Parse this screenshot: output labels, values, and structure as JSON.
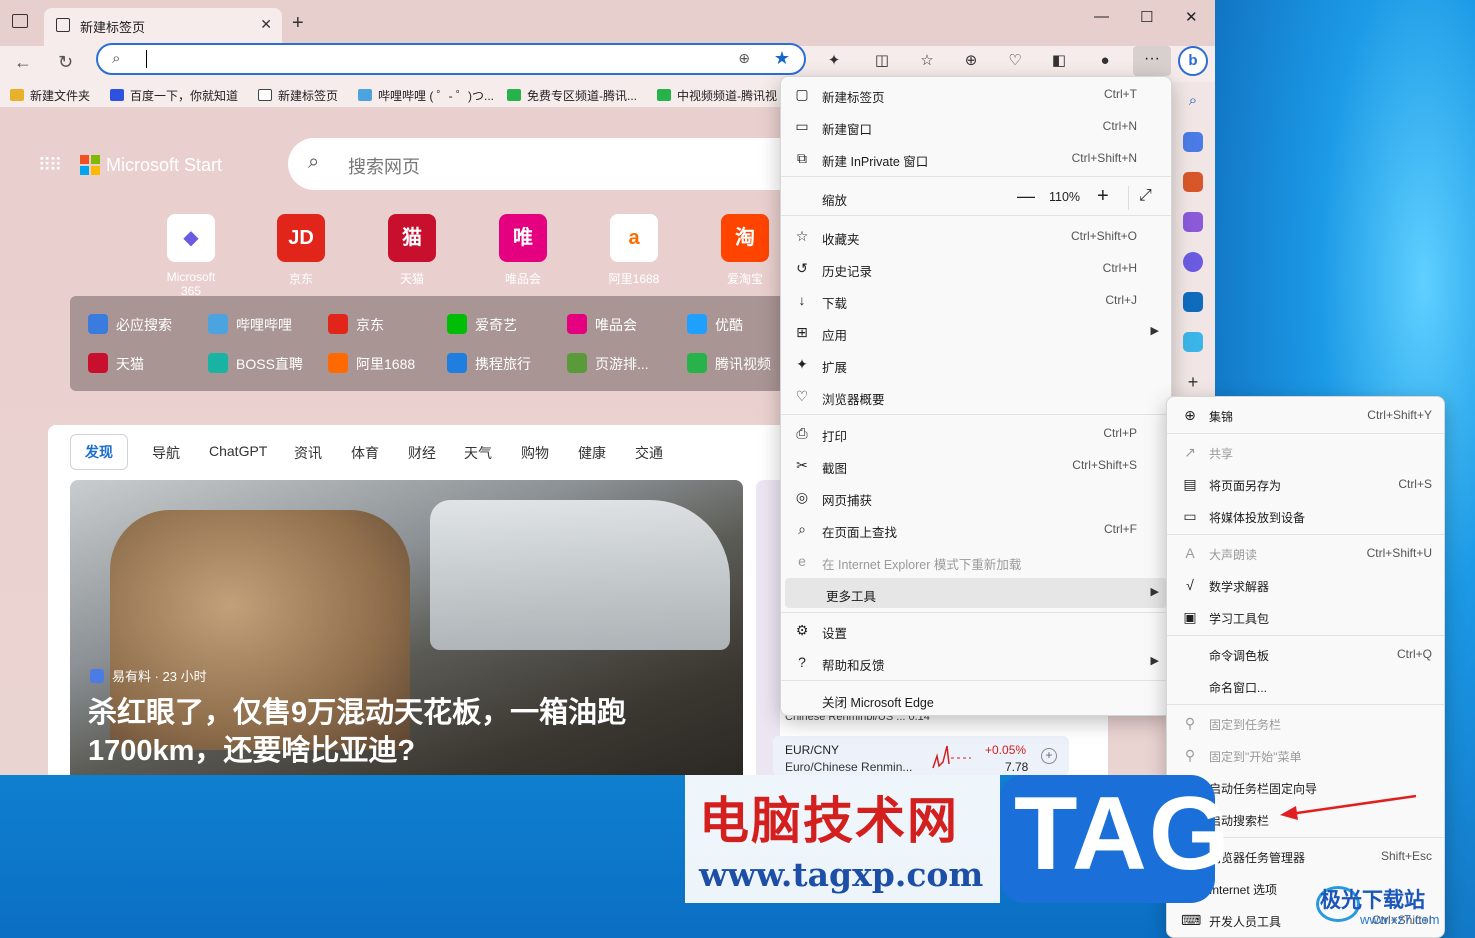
{
  "browser": {
    "tab_title": "新建标签页",
    "fav_bar": [
      {
        "label": "新建文件夹",
        "color": "#e8b12c"
      },
      {
        "label": "百度一下，你就知道",
        "color": "#2d52e0"
      },
      {
        "label": "新建标签页",
        "color": "#444444"
      },
      {
        "label": "哔哩哔哩 ( ゜- ゜)つ...",
        "color": "#4ba3e0"
      },
      {
        "label": "免费专区频道-腾讯...",
        "color": "#27b24a"
      },
      {
        "label": "中视频频道-腾讯视",
        "color": "#27b24a"
      }
    ]
  },
  "newtab": {
    "brand": "Microsoft Start",
    "search_placeholder": "搜索网页",
    "quick_links": [
      {
        "label": "Microsoft 365",
        "glyph": "◆",
        "color": "#6a5be0"
      },
      {
        "label": "京东",
        "glyph": "JD",
        "color": "#e1251b"
      },
      {
        "label": "天猫",
        "glyph": "猫",
        "color": "#c8102e"
      },
      {
        "label": "唯品会",
        "glyph": "唯",
        "color": "#e4007f"
      },
      {
        "label": "阿里1688",
        "glyph": "a",
        "color": "#ff6a00"
      },
      {
        "label": "爱淘宝",
        "glyph": "淘",
        "color": "#ff4400"
      }
    ],
    "panel_links": [
      {
        "label": "必应搜索",
        "color": "#3a7be0"
      },
      {
        "label": "哔哩哔哩",
        "color": "#4ba3e0"
      },
      {
        "label": "京东",
        "color": "#e1251b"
      },
      {
        "label": "爱奇艺",
        "color": "#00be06"
      },
      {
        "label": "唯品会",
        "color": "#e4007f"
      },
      {
        "label": "优酷",
        "color": "#1fa0ff"
      },
      {
        "label": "天猫",
        "color": "#c8102e"
      },
      {
        "label": "BOSS直聘",
        "color": "#19b3a3"
      },
      {
        "label": "阿里1688",
        "color": "#ff6a00"
      },
      {
        "label": "携程旅行",
        "color": "#1f7ee0"
      },
      {
        "label": "页游排...",
        "color": "#5b9a3a"
      },
      {
        "label": "腾讯视频",
        "color": "#27b24a"
      }
    ],
    "feed_tabs": [
      "发现",
      "导航",
      "ChatGPT",
      "资讯",
      "体育",
      "财经",
      "天气",
      "购物",
      "健康",
      "交通"
    ],
    "hero": {
      "source": "易有料 · 23 小时",
      "headline": "杀红眼了，仅售9万混动天花板，一箱油跑1700km，还要啥比亚迪?"
    },
    "stock": {
      "partial_top": "Chinese Renminbi/US ...            0.14",
      "pair": "EUR/CNY",
      "name": "Euro/Chinese Renmin...",
      "change": "+0.05%",
      "value": "7.78"
    }
  },
  "menu": {
    "items": [
      {
        "icon": "▢",
        "label": "新建标签页",
        "shortcut": "Ctrl+T"
      },
      {
        "icon": "▭",
        "label": "新建窗口",
        "shortcut": "Ctrl+N"
      },
      {
        "icon": "⧉",
        "label": "新建 InPrivate 窗口",
        "shortcut": "Ctrl+Shift+N"
      },
      {
        "icon": "",
        "label": "缩放",
        "shortcut": ""
      },
      {
        "icon": "☆",
        "label": "收藏夹",
        "shortcut": "Ctrl+Shift+O"
      },
      {
        "icon": "↺",
        "label": "历史记录",
        "shortcut": "Ctrl+H"
      },
      {
        "icon": "↓",
        "label": "下载",
        "shortcut": "Ctrl+J"
      },
      {
        "icon": "⊞",
        "label": "应用",
        "shortcut": ""
      },
      {
        "icon": "✦",
        "label": "扩展",
        "shortcut": ""
      },
      {
        "icon": "♡",
        "label": "浏览器概要",
        "shortcut": ""
      },
      {
        "icon": "⎙",
        "label": "打印",
        "shortcut": "Ctrl+P"
      },
      {
        "icon": "✂",
        "label": "截图",
        "shortcut": "Ctrl+Shift+S"
      },
      {
        "icon": "◎",
        "label": "网页捕获",
        "shortcut": ""
      },
      {
        "icon": "⌕",
        "label": "在页面上查找",
        "shortcut": "Ctrl+F"
      },
      {
        "icon": "e",
        "label": "在 Internet Explorer 模式下重新加载",
        "shortcut": ""
      },
      {
        "icon": "",
        "label": "更多工具",
        "shortcut": ""
      },
      {
        "icon": "⚙",
        "label": "设置",
        "shortcut": ""
      },
      {
        "icon": "?",
        "label": "帮助和反馈",
        "shortcut": ""
      },
      {
        "icon": "",
        "label": "关闭 Microsoft Edge",
        "shortcut": ""
      }
    ],
    "zoom_value": "110%"
  },
  "submenu": {
    "items": [
      {
        "icon": "⊕",
        "label": "集锦",
        "shortcut": "Ctrl+Shift+Y"
      },
      {
        "icon": "↗",
        "label": "共享",
        "shortcut": ""
      },
      {
        "icon": "▤",
        "label": "将页面另存为",
        "shortcut": "Ctrl+S"
      },
      {
        "icon": "▭",
        "label": "将媒体投放到设备",
        "shortcut": ""
      },
      {
        "icon": "A",
        "label": "大声朗读",
        "shortcut": "Ctrl+Shift+U"
      },
      {
        "icon": "√",
        "label": "数学求解器",
        "shortcut": ""
      },
      {
        "icon": "▣",
        "label": "学习工具包",
        "shortcut": ""
      },
      {
        "icon": "",
        "label": "命令调色板",
        "shortcut": "Ctrl+Q"
      },
      {
        "icon": "",
        "label": "命名窗口...",
        "shortcut": ""
      },
      {
        "icon": "⚲",
        "label": "固定到任务栏",
        "shortcut": ""
      },
      {
        "icon": "⚲",
        "label": "固定到\"开始\"菜单",
        "shortcut": ""
      },
      {
        "icon": "",
        "label": "启动任务栏固定向导",
        "shortcut": ""
      },
      {
        "icon": "",
        "label": "启动搜索栏",
        "shortcut": ""
      },
      {
        "icon": "",
        "label": "浏览器任务管理器",
        "shortcut": "Shift+Esc"
      },
      {
        "icon": "",
        "label": "Internet 选项",
        "shortcut": ""
      },
      {
        "icon": "⌨",
        "label": "开发人员工具",
        "shortcut": "Ctrl+Shift+I"
      }
    ]
  },
  "watermark": {
    "site_cn": "电脑技术网",
    "site_url": "www.tagxp.com",
    "tag": "TAG",
    "jiguang": "极光下载站",
    "jiguang_url": "www.xz7.com"
  }
}
